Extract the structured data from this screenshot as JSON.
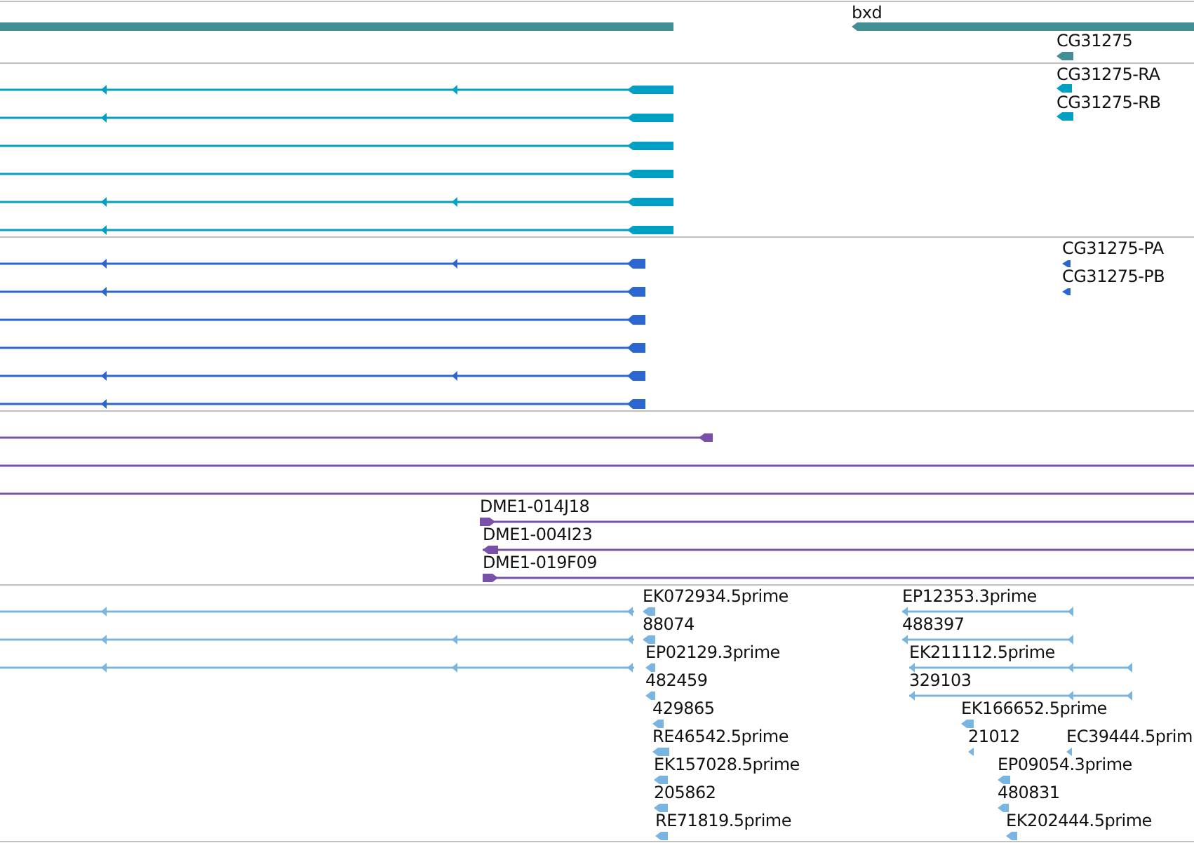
{
  "tracks": [
    {
      "kind": "gene",
      "labels": [
        "bxd",
        "CG31275"
      ]
    },
    {
      "kind": "transcript",
      "labels": [
        "CG31275-RA",
        "CG31275-RB"
      ]
    },
    {
      "kind": "protein",
      "labels": [
        "CG31275-PA",
        "CG31275-PB"
      ]
    },
    {
      "kind": "clone",
      "labels": [
        "DME1-014J18",
        "DME1-004I23",
        "DME1-019F09"
      ]
    },
    {
      "kind": "est",
      "labels": [
        "EK072934.5prime",
        "88074",
        "EP02129.3prime",
        "482459",
        "429865",
        "RE46542.5prime",
        "EK157028.5prime",
        "205862",
        "RE71819.5prime",
        "EP12353.3prime",
        "488397",
        "EK211112.5prime",
        "329103",
        "EK166652.5prime",
        "21012",
        "EC39444.5prim",
        "EP09054.3prime",
        "480831",
        "EK202444.5prime"
      ]
    }
  ]
}
